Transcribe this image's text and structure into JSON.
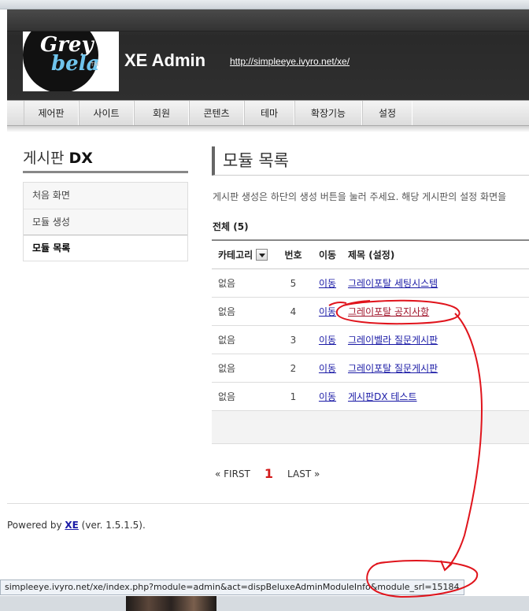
{
  "header": {
    "logo_line1": "Grey",
    "logo_line2": "bela",
    "logo_tm": "TM",
    "title": "XE Admin",
    "url": "http://simpleeye.ivyro.net/xe/"
  },
  "gnb": {
    "items": [
      "제어판",
      "사이트",
      "회원",
      "콘텐츠",
      "테마",
      "확장기능",
      "설정"
    ]
  },
  "sidebar": {
    "title_prefix": "게시판",
    "title_bold": "DX",
    "items": [
      {
        "label": "처음 화면"
      },
      {
        "label": "모듈 생성"
      },
      {
        "label": "모듈 목록"
      }
    ]
  },
  "main": {
    "title": "모듈 목록",
    "description": "게시판 생성은 하단의 생성 버튼을 눌러 주세요. 해당 게시판의 설정 화면을",
    "total_label": "전체 (5)",
    "columns": [
      "카테고리",
      "번호",
      "이동",
      "제목 (설정)"
    ],
    "rows": [
      {
        "category": "없음",
        "no": "5",
        "move": "이동",
        "title": "그레이포탈 세팅시스템"
      },
      {
        "category": "없음",
        "no": "4",
        "move": "이동",
        "title": "그레이포탈 공지사항"
      },
      {
        "category": "없음",
        "no": "3",
        "move": "이동",
        "title": "그레이벨라 질문게시판"
      },
      {
        "category": "없음",
        "no": "2",
        "move": "이동",
        "title": "그레이포탈 질문게시판"
      },
      {
        "category": "없음",
        "no": "1",
        "move": "이동",
        "title": "게시판DX 테스트"
      }
    ]
  },
  "pager": {
    "first": "« FIRST",
    "current": "1",
    "last": "LAST »"
  },
  "footer": {
    "powered": "Powered by",
    "xe": "XE",
    "version": "(ver. 1.5.1.5)."
  },
  "status": {
    "url": "simpleeye.ivyro.net/xe/index.php?module=admin&act=dispBeluxeAdminModuleInfo&module_srl=15184"
  },
  "colors": {
    "annotation": "#e0141c",
    "link": "#1a1aa6"
  }
}
